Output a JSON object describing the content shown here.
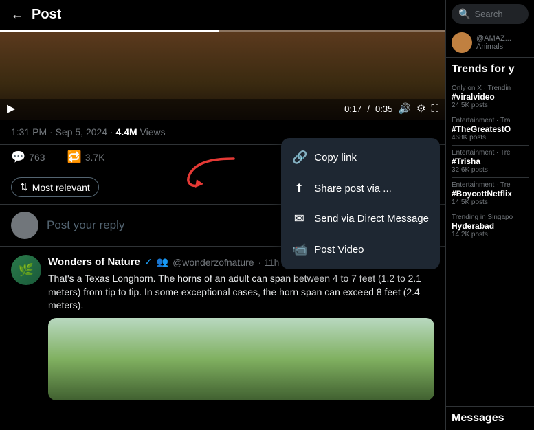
{
  "header": {
    "back_label": "←",
    "title": "Post"
  },
  "video": {
    "time_current": "0:17",
    "time_total": "0:35",
    "progress_pct": 49
  },
  "post_meta": {
    "time": "1:31 PM · Sep 5, 2024 · ",
    "views": "4.4M",
    "views_label": " Views"
  },
  "actions": {
    "replies": "763",
    "retweets": "3.7K"
  },
  "context_menu": {
    "items": [
      {
        "icon": "🔗",
        "label": "Copy link"
      },
      {
        "icon": "↑",
        "label": "Share post via ..."
      },
      {
        "icon": "✉",
        "label": "Send via Direct Message"
      },
      {
        "icon": "🎬",
        "label": "Post Video"
      }
    ]
  },
  "filter": {
    "label": "Most relevant"
  },
  "reply_input": {
    "placeholder": "Post your reply"
  },
  "comment": {
    "name": "Wonders of Nature",
    "handle": "@wonderzofnature",
    "time": "· 11h",
    "text": "That's a Texas Longhorn. The horns of an adult can span between 4 to 7 feet (1.2 to 2.1 meters) from tip to tip. In some exceptional cases, the horn span can exceed 8 feet (2.4 meters).",
    "more_icon": "···"
  },
  "right_panel": {
    "search_placeholder": "Search",
    "user": {
      "handle": "@AMAZ...",
      "sub": "Animals"
    },
    "trends_title": "Trends for y",
    "trends": [
      {
        "category": "Only on X · Trendin",
        "hashtag": "#viralvideo",
        "count": "24.5K posts"
      },
      {
        "category": "Entertainment · Tra",
        "hashtag": "#TheGreatestO",
        "count": "468K posts"
      },
      {
        "category": "Entertainment · Tre",
        "hashtag": "#Trisha",
        "count": "32.6K posts"
      },
      {
        "category": "Entertainment · Tre",
        "hashtag": "#BoycottNetflix",
        "count": "14.5K posts"
      },
      {
        "category": "Trending in Singapo",
        "hashtag": "Hyderabad",
        "count": "14.2K posts"
      }
    ],
    "messages_title": "Messages"
  }
}
